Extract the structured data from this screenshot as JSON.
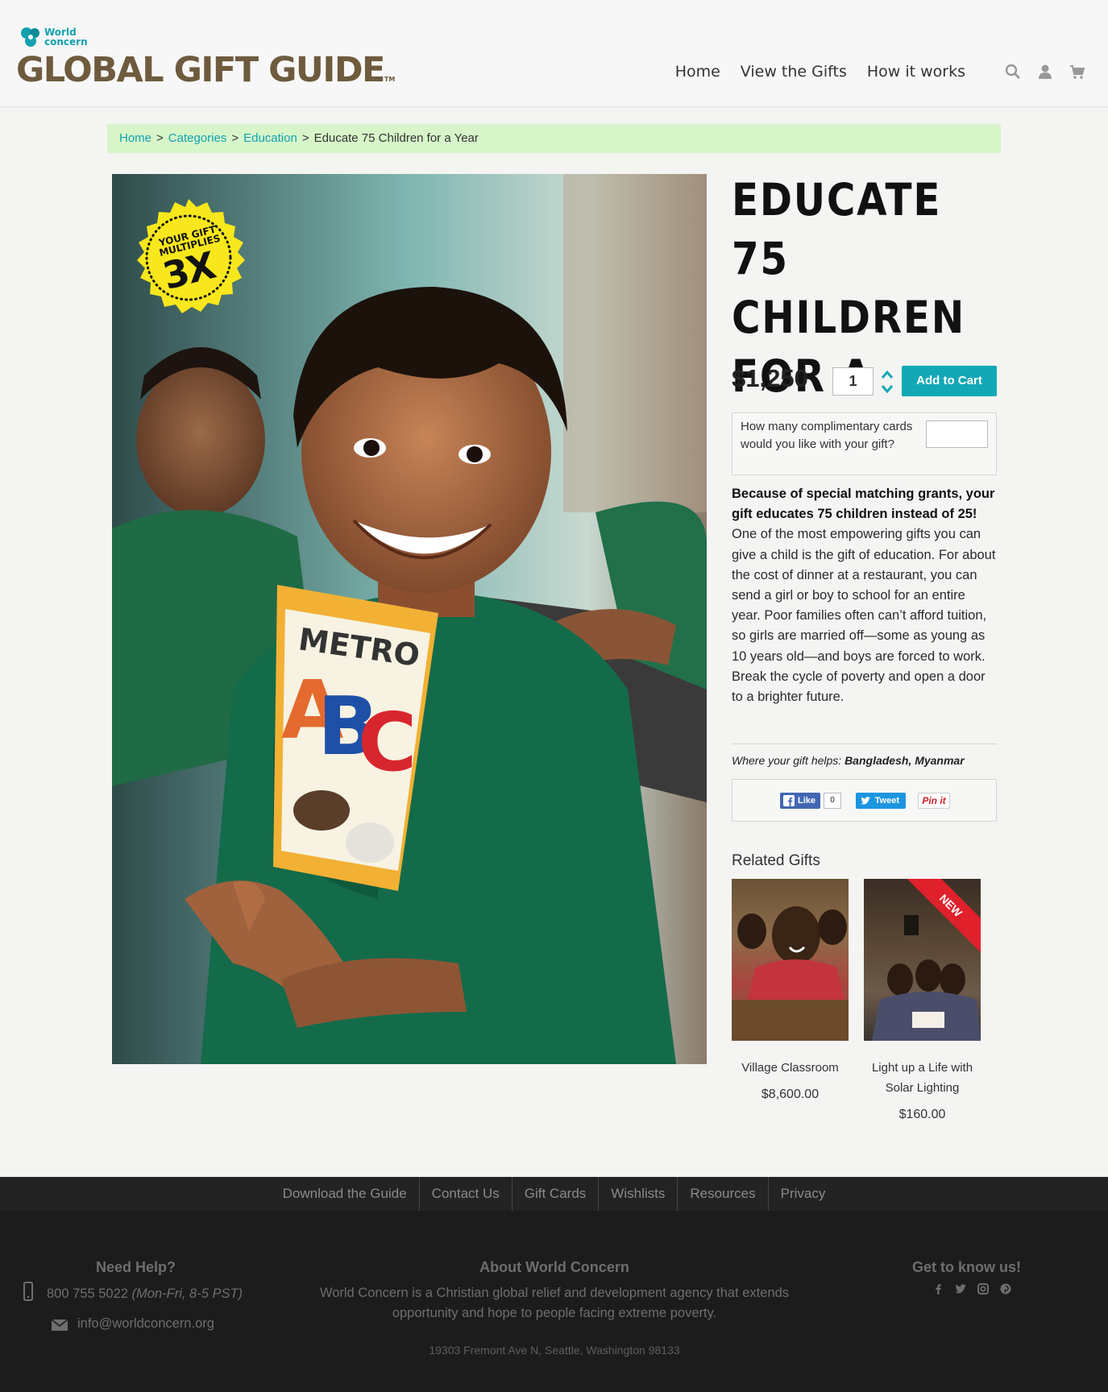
{
  "header": {
    "brand_small": "World concern",
    "brand_big": "GLOBAL GIFT GUIDE",
    "brand_tm": "TM",
    "nav": [
      "Home",
      "View the Gifts",
      "How it works"
    ],
    "icons": [
      "search-icon",
      "user-icon",
      "cart-icon"
    ]
  },
  "breadcrumb": {
    "items": [
      "Home",
      "Categories",
      "Education"
    ],
    "current": "Educate 75 Children for a Year",
    "separator": ">"
  },
  "badge": {
    "line1": "YOUR GIFT",
    "line2": "MULTIPLIES",
    "multiplier": "3X"
  },
  "product": {
    "title": "Educate 75 Children for a Year",
    "price": "$1,250",
    "quantity": "1",
    "add_to_cart": "Add to Cart",
    "cards_question": "How many complimentary cards would you like with your gift?",
    "cards_value": "",
    "description_bold": "Because of special matching grants, your gift educates 75 children instead of 25!",
    "description": " One of the most empowering gifts you can give a child is the gift of education. For about the cost of dinner at a restaurant, you can send a girl or boy to school for an entire year. Poor families often can’t afford tuition, so girls are married off—some as young as 10 years old—and boys are forced to work. Break the cycle of poverty and open a door to a brighter future.",
    "helps_label": "Where your gift helps:",
    "helps_value": "Bangladesh, Myanmar"
  },
  "share": {
    "like": "Like",
    "like_count": "0",
    "tweet": "Tweet",
    "pin": "Pin it"
  },
  "related": {
    "heading": "Related Gifts",
    "items": [
      {
        "name": "Village Classroom",
        "price": "$8,600.00",
        "ribbon": ""
      },
      {
        "name": "Light up a Life with Solar Lighting",
        "price": "$160.00",
        "ribbon": "NEW"
      }
    ]
  },
  "footer_nav": [
    "Download the Guide",
    "Contact Us",
    "Gift Cards",
    "Wishlists",
    "Resources",
    "Privacy"
  ],
  "footer": {
    "help_heading": "Need Help?",
    "phone": "800 755 5022",
    "phone_hours": "(Mon-Fri, 8-5 PST)",
    "email": "info@worldconcern.org",
    "about_heading": "About World Concern",
    "about_text": "World Concern is a Christian global relief and development agency that extends opportunity and hope to people facing extreme poverty.",
    "address": "19303 Fremont Ave N, Seattle, Washington 98133",
    "social_heading": "Get to know us!",
    "social_icons": [
      "facebook-icon",
      "twitter-icon",
      "instagram-icon",
      "pinterest-icon"
    ]
  },
  "colors": {
    "accent": "#13a8b5",
    "brand_brown": "#6e5b3e",
    "breadcrumb_bg": "#d7f5c9",
    "badge_yellow": "#f8e71c",
    "ribbon_red": "#e0202b",
    "footer_bg": "#1c1c1c"
  }
}
